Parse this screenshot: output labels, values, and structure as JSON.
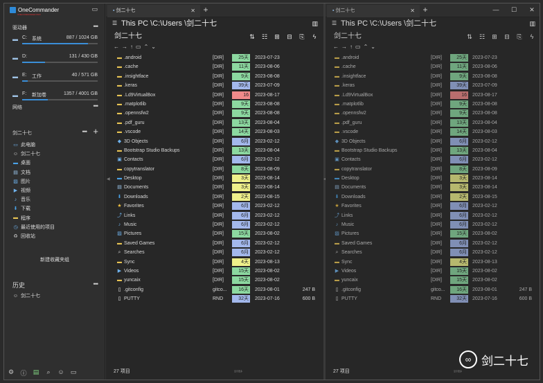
{
  "app": {
    "title": "OneCommander",
    "subtitle": "ONECOMMANDER PRO"
  },
  "colors": {
    "folder": "#e8c454",
    "accent": "#3b8fd9",
    "age_green": "#8cd8a0",
    "age_blue": "#a3b8ec",
    "age_yellow": "#eef08a",
    "age_red": "#f08a8a"
  },
  "sidebar": {
    "drives_header": "驱动器",
    "drives": [
      {
        "letter": "C:",
        "name": "系统",
        "size": "887 / 1024 GB",
        "fill": 0.87
      },
      {
        "letter": "D:",
        "name": "",
        "size": "131 / 430 GB",
        "fill": 0.3
      },
      {
        "letter": "E:",
        "name": "工作",
        "size": "40 / 571 GB",
        "fill": 0.07
      },
      {
        "letter": "F:",
        "name": "新加卷",
        "size": "1357 / 4001 GB",
        "fill": 0.34
      }
    ],
    "network_header": "网络",
    "favorites_header": "剑二十七",
    "favorites": [
      {
        "icon": "pc-icon",
        "label": "此电脑"
      },
      {
        "icon": "user-icon",
        "label": "剑二十七"
      },
      {
        "icon": "desktop-icon",
        "label": "桌面"
      },
      {
        "icon": "document-icon",
        "label": "文档"
      },
      {
        "icon": "pictures-icon",
        "label": "图片"
      },
      {
        "icon": "videos-icon",
        "label": "视频"
      },
      {
        "icon": "music-icon",
        "label": "音乐"
      },
      {
        "icon": "download-icon",
        "label": "下载"
      },
      {
        "icon": "folder-icon",
        "label": "程序"
      },
      {
        "icon": "recent-icon",
        "label": "最近使用的项目"
      },
      {
        "icon": "recycle-icon",
        "label": "回收站"
      }
    ],
    "new_group": "新建收藏夹组",
    "history_header": "历史",
    "history": [
      {
        "icon": "user-icon",
        "label": "剑二十七"
      }
    ]
  },
  "left_pane": {
    "tab": "剑二十七",
    "path": "This PC \\C:\\Users \\剑二十七",
    "header": "剑二十七",
    "count": "27 项目",
    "mini_label": "显示更多"
  },
  "right_pane": {
    "tab": "剑二十七",
    "path": "This PC \\C:\\Users \\剑二十七",
    "header": "剑二十七",
    "count": "27 项目",
    "mini_label": "显示更多"
  },
  "files": [
    {
      "icon": "folder-icon",
      "name": ".android",
      "type": "[DIR]",
      "age": "25天",
      "age_color": "age_green",
      "date": "2023-07-23",
      "size": ""
    },
    {
      "icon": "folder-icon",
      "name": ".cache",
      "type": "[DIR]",
      "age": "11天",
      "age_color": "age_green",
      "date": "2023-08-06",
      "size": ""
    },
    {
      "icon": "folder-icon",
      "name": ".insightface",
      "type": "[DIR]",
      "age": "9天",
      "age_color": "age_green",
      "date": "2023-08-08",
      "size": ""
    },
    {
      "icon": "folder-icon",
      "name": ".keras",
      "type": "[DIR]",
      "age": "39天",
      "age_color": "age_blue",
      "date": "2023-07-09",
      "size": ""
    },
    {
      "icon": "folder-icon",
      "name": ".Ld9VirtualBox",
      "type": "[DIR]",
      "age": "16",
      "age_color": "age_red",
      "date": "2023-08-17",
      "size": ""
    },
    {
      "icon": "folder-icon",
      "name": ".matplotlib",
      "type": "[DIR]",
      "age": "9天",
      "age_color": "age_green",
      "date": "2023-08-08",
      "size": ""
    },
    {
      "icon": "folder-icon",
      "name": ".opennsfw2",
      "type": "[DIR]",
      "age": "9天",
      "age_color": "age_green",
      "date": "2023-08-08",
      "size": ""
    },
    {
      "icon": "folder-icon",
      "name": ".pdf_guru",
      "type": "[DIR]",
      "age": "13天",
      "age_color": "age_green",
      "date": "2023-08-04",
      "size": ""
    },
    {
      "icon": "folder-icon",
      "name": ".vscode",
      "type": "[DIR]",
      "age": "14天",
      "age_color": "age_green",
      "date": "2023-08-03",
      "size": ""
    },
    {
      "icon": "cube-icon",
      "name": "3D Objects",
      "type": "[DIR]",
      "age": "6月",
      "age_color": "age_blue",
      "date": "2023-02-12",
      "size": ""
    },
    {
      "icon": "folder-icon",
      "name": "Bootstrap Studio Backups",
      "type": "[DIR]",
      "age": "13天",
      "age_color": "age_green",
      "date": "2023-08-04",
      "size": ""
    },
    {
      "icon": "contacts-icon",
      "name": "Contacts",
      "type": "[DIR]",
      "age": "6月",
      "age_color": "age_blue",
      "date": "2023-02-12",
      "size": ""
    },
    {
      "icon": "folder-icon",
      "name": "copytranslator",
      "type": "[DIR]",
      "age": "8天",
      "age_color": "age_green",
      "date": "2023-08-09",
      "size": ""
    },
    {
      "icon": "desktop-icon",
      "name": "Desktop",
      "type": "[DIR]",
      "age": "3天",
      "age_color": "age_yellow",
      "date": "2023-08-14",
      "size": ""
    },
    {
      "icon": "document-icon",
      "name": "Documents",
      "type": "[DIR]",
      "age": "3天",
      "age_color": "age_yellow",
      "date": "2023-08-14",
      "size": ""
    },
    {
      "icon": "download-icon",
      "name": "Downloads",
      "type": "[DIR]",
      "age": "2天",
      "age_color": "age_yellow",
      "date": "2023-08-15",
      "size": ""
    },
    {
      "icon": "star-icon",
      "name": "Favorites",
      "type": "[DIR]",
      "age": "6月",
      "age_color": "age_blue",
      "date": "2023-02-12",
      "size": ""
    },
    {
      "icon": "link-icon",
      "name": "Links",
      "type": "[DIR]",
      "age": "6月",
      "age_color": "age_blue",
      "date": "2023-02-12",
      "size": ""
    },
    {
      "icon": "music-icon",
      "name": "Music",
      "type": "[DIR]",
      "age": "6月",
      "age_color": "age_blue",
      "date": "2023-02-12",
      "size": ""
    },
    {
      "icon": "pictures-icon",
      "name": "Pictures",
      "type": "[DIR]",
      "age": "15天",
      "age_color": "age_green",
      "date": "2023-08-02",
      "size": ""
    },
    {
      "icon": "folder-icon",
      "name": "Saved Games",
      "type": "[DIR]",
      "age": "6月",
      "age_color": "age_blue",
      "date": "2023-02-12",
      "size": ""
    },
    {
      "icon": "search-icon",
      "name": "Searches",
      "type": "[DIR]",
      "age": "6月",
      "age_color": "age_blue",
      "date": "2023-02-12",
      "size": ""
    },
    {
      "icon": "folder-icon",
      "name": "Sync",
      "type": "[DIR]",
      "age": "4天",
      "age_color": "age_yellow",
      "date": "2023-08-13",
      "size": ""
    },
    {
      "icon": "videos-icon",
      "name": "Videos",
      "type": "[DIR]",
      "age": "15天",
      "age_color": "age_green",
      "date": "2023-08-02",
      "size": ""
    },
    {
      "icon": "folder-icon",
      "name": "yuncaix",
      "type": "[DIR]",
      "age": "15天",
      "age_color": "age_green",
      "date": "2023-08-02",
      "size": ""
    },
    {
      "icon": "file-icon",
      "name": ".gitconfig",
      "type": "gitco...",
      "age": "16天",
      "age_color": "age_green",
      "date": "2023-08-01",
      "size": "247 B"
    },
    {
      "icon": "file-icon",
      "name": "PUTTY",
      "type": "RND",
      "age": "32天",
      "age_color": "age_blue",
      "date": "2023-07-16",
      "size": "600 B"
    }
  ],
  "watermark": {
    "text": "剑二十七"
  }
}
